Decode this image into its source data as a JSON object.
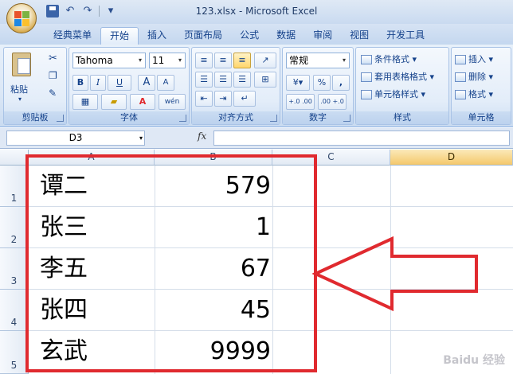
{
  "window": {
    "title": "123.xlsx - Microsoft Excel"
  },
  "tabs": [
    {
      "label": "经典菜单",
      "active": false
    },
    {
      "label": "开始",
      "active": true
    },
    {
      "label": "插入",
      "active": false
    },
    {
      "label": "页面布局",
      "active": false
    },
    {
      "label": "公式",
      "active": false
    },
    {
      "label": "数据",
      "active": false
    },
    {
      "label": "审阅",
      "active": false
    },
    {
      "label": "视图",
      "active": false
    },
    {
      "label": "开发工具",
      "active": false
    }
  ],
  "ribbon": {
    "clipboard": {
      "label": "剪贴板",
      "paste": "粘贴"
    },
    "font": {
      "label": "字体",
      "font_name": "Tahoma",
      "font_size": "11",
      "bold": "B",
      "italic": "I",
      "underline": "U",
      "grow": "A",
      "shrink": "A",
      "phonetic": "wén",
      "font_color_glyph": "A"
    },
    "alignment": {
      "label": "对齐方式"
    },
    "number": {
      "label": "数字",
      "format": "常规",
      "percent": "%",
      "comma": ",",
      "inc_decimal": "+.0 .00",
      "dec_decimal": ".00 +.0"
    },
    "styles": {
      "label": "样式",
      "conditional": "条件格式",
      "table": "套用表格格式",
      "cell": "单元格样式"
    },
    "cells": {
      "label": "单元格",
      "insert": "插入",
      "delete": "删除",
      "format": "格式"
    }
  },
  "formula_bar": {
    "name_box": "D3",
    "fx": "fx",
    "value": ""
  },
  "columns": [
    "A",
    "B",
    "C",
    "D"
  ],
  "rows": [
    {
      "num": "1",
      "name": "谭二",
      "value": "579"
    },
    {
      "num": "2",
      "name": "张三",
      "value": "1"
    },
    {
      "num": "3",
      "name": "李五",
      "value": "67"
    },
    {
      "num": "4",
      "name": "张四",
      "value": "45"
    },
    {
      "num": "5",
      "name": "玄武",
      "value": "9999"
    }
  ],
  "annotation_color": "#e02a2f",
  "watermark": "Baidu 经验"
}
